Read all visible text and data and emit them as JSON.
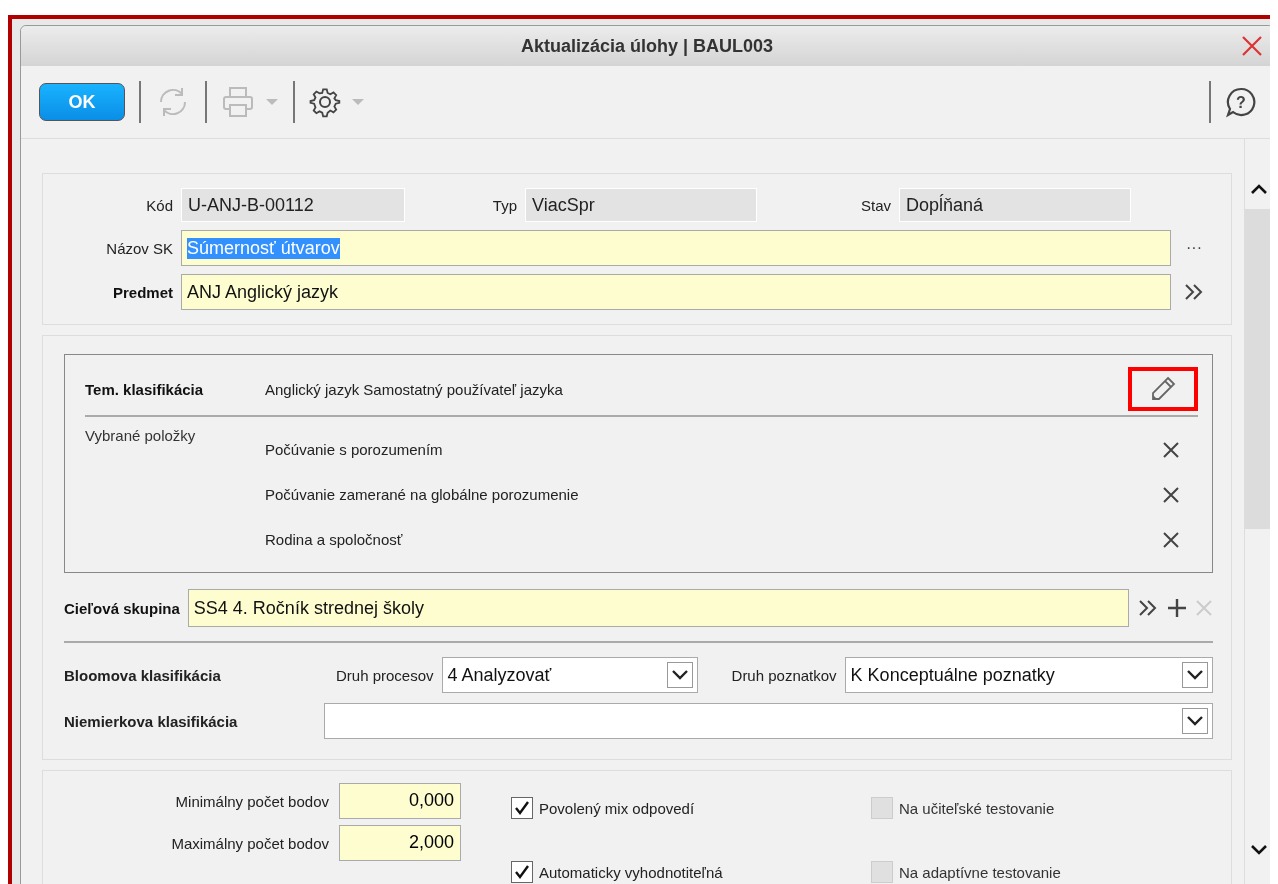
{
  "window": {
    "title": "Aktualizácia úlohy | BAUL003"
  },
  "toolbar": {
    "ok_label": "OK",
    "help_label": "?"
  },
  "header": {
    "code": {
      "label": "Kód",
      "value": "U-ANJ-B-00112"
    },
    "type": {
      "label": "Typ",
      "value": "ViacSpr"
    },
    "state": {
      "label": "Stav",
      "value": "Dopĺňaná"
    },
    "name": {
      "label": "Názov SK",
      "value": "Súmernosť útvarov",
      "text_selected": true,
      "more_label": "···"
    },
    "subject": {
      "label": "Predmet",
      "value": "ANJ Anglický jazyk"
    }
  },
  "classification": {
    "label": "Tem. klasifikácia",
    "value": "Anglický jazyk Samostatný používateľ jazyka",
    "edit_highlighted": true,
    "selected_label": "Vybrané položky",
    "items": [
      {
        "text": "Počúvanie s porozumením"
      },
      {
        "text": "Počúvanie zamerané na globálne porozumenie"
      },
      {
        "text": "Rodina a spoločnosť"
      }
    ]
  },
  "target_group": {
    "label": "Cieľová skupina",
    "value": "SS4 4. Ročník strednej školy"
  },
  "bloom": {
    "label": "Bloomova klasifikácia",
    "process_label": "Druh procesov",
    "process_value": "4 Analyzovať",
    "knowledge_label": "Druh poznatkov",
    "knowledge_value": "K Konceptuálne poznatky"
  },
  "niemierko": {
    "label": "Niemierkova klasifikácia"
  },
  "points": [
    {
      "label": "Minimálny počet bodov",
      "value": "0,000"
    },
    {
      "label": "Maximálny počet bodov",
      "value": "2,000"
    }
  ],
  "options": [
    {
      "label": "Povolený mix odpovedí",
      "checked": true,
      "disabled": false
    },
    {
      "label": "Na učiteľské testovanie",
      "checked": false,
      "disabled": true
    },
    {
      "label": "Automaticky vyhodnotiteľná",
      "checked": true,
      "disabled": false
    },
    {
      "label": "Na adaptívne testovanie",
      "checked": false,
      "disabled": true
    }
  ]
}
